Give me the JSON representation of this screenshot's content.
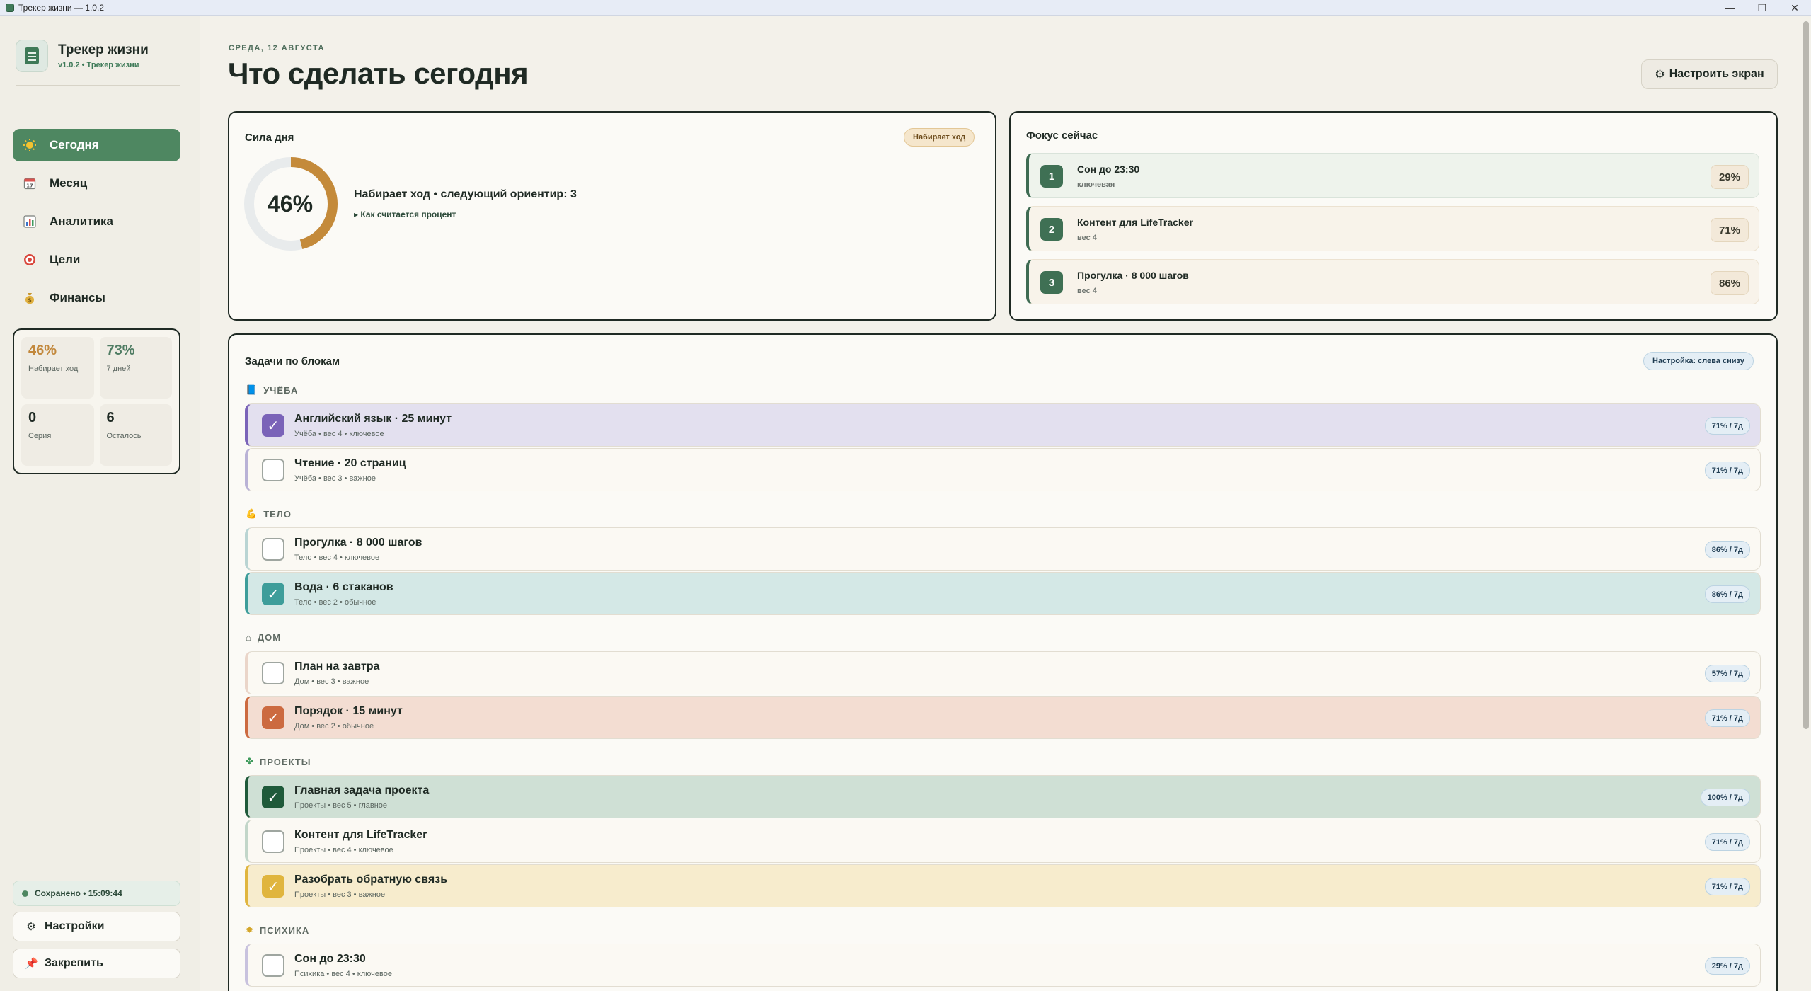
{
  "window": {
    "title": "Трекер жизни — 1.0.2",
    "controls": [
      "—",
      "❐",
      "✕"
    ]
  },
  "sidebar": {
    "brand_title": "Трекер жизни",
    "brand_sub": "v1.0.2 • Трекер жизни",
    "nav": [
      {
        "label": "Сегодня",
        "icon": "sun-icon"
      },
      {
        "label": "Месяц",
        "icon": "calendar-icon"
      },
      {
        "label": "Аналитика",
        "icon": "bar-chart-icon"
      },
      {
        "label": "Цели",
        "icon": "target-icon"
      },
      {
        "label": "Финансы",
        "icon": "money-bag-icon"
      }
    ],
    "stats": [
      {
        "value": "46%",
        "label": "Набирает ход"
      },
      {
        "value": "73%",
        "label": "7 дней"
      },
      {
        "value": "0",
        "label": "Серия"
      },
      {
        "value": "6",
        "label": "Осталось"
      }
    ],
    "saved": "Сохранено • 15:09:44",
    "settings_label": "Настройки",
    "pin_label": "Закрепить"
  },
  "header": {
    "date": "СРЕДА, 12 АВГУСТА",
    "title": "Что сделать сегодня",
    "config_button": "Настроить экран"
  },
  "power": {
    "title": "Сила дня",
    "badge": "Набирает ход",
    "percent_text": "46%",
    "percent_value": 46,
    "line": "Набирает ход • следующий ориентир: 3",
    "how": "Как считается процент",
    "colors": {
      "ring": "#c48a3a",
      "track": "#e8ebec"
    }
  },
  "focus": {
    "title": "Фокус сейчас",
    "items": [
      {
        "num": "1",
        "title": "Сон до 23:30",
        "sub": "ключевая",
        "pct": "29%"
      },
      {
        "num": "2",
        "title": "Контент для LifeTracker",
        "sub": "вес 4",
        "pct": "71%"
      },
      {
        "num": "3",
        "title": "Прогулка · 8 000 шагов",
        "sub": "вес 4",
        "pct": "86%"
      }
    ]
  },
  "tasks": {
    "title": "Задачи по блокам",
    "badge": "Настройка: слева снизу",
    "sections": [
      {
        "name": "УЧЁБА",
        "icon": "book-icon",
        "items": [
          {
            "title": "Английский язык · 25 минут",
            "sub": "Учёба • вес 4 • ключевое",
            "badge": "71% / 7д",
            "done": true,
            "color": "#7a63b8",
            "bg": "#e3e0ef"
          },
          {
            "title": "Чтение · 20 страниц",
            "sub": "Учёба • вес 3 • важное",
            "badge": "71% / 7д",
            "done": false,
            "color": "#b9b2d6",
            "bg": "#fbf9f3"
          }
        ]
      },
      {
        "name": "ТЕЛО",
        "icon": "muscle-icon",
        "items": [
          {
            "title": "Прогулка · 8 000 шагов",
            "sub": "Тело • вес 4 • ключевое",
            "badge": "86% / 7д",
            "done": false,
            "color": "#b9d4d3",
            "bg": "#fbf9f3"
          },
          {
            "title": "Вода · 6 стаканов",
            "sub": "Тело • вес 2 • обычное",
            "badge": "86% / 7д",
            "done": true,
            "color": "#3e9d9a",
            "bg": "#d4e8e6"
          }
        ]
      },
      {
        "name": "ДОМ",
        "icon": "house-icon",
        "items": [
          {
            "title": "План на завтра",
            "sub": "Дом • вес 3 • важное",
            "badge": "57% / 7д",
            "done": false,
            "color": "#ead5c9",
            "bg": "#fbf9f3"
          },
          {
            "title": "Порядок · 15 минут",
            "sub": "Дом • вес 2 • обычное",
            "badge": "71% / 7д",
            "done": true,
            "color": "#cc6a40",
            "bg": "#f3ddd2"
          }
        ]
      },
      {
        "name": "ПРОЕКТЫ",
        "icon": "puzzle-icon",
        "items": [
          {
            "title": "Главная задача проекта",
            "sub": "Проекты • вес 5 • главное",
            "badge": "100% / 7д",
            "done": true,
            "color": "#1f5a3a",
            "bg": "#cfe0d5"
          },
          {
            "title": "Контент для LifeTracker",
            "sub": "Проекты • вес 4 • ключевое",
            "badge": "71% / 7д",
            "done": false,
            "color": "#c2d6c9",
            "bg": "#fbf9f3"
          },
          {
            "title": "Разобрать обратную связь",
            "sub": "Проекты • вес 3 • важное",
            "badge": "71% / 7д",
            "done": true,
            "color": "#e0b53e",
            "bg": "#f7eccd"
          }
        ]
      },
      {
        "name": "ПСИХИКА",
        "icon": "sparkle-icon",
        "items": [
          {
            "title": "Сон до 23:30",
            "sub": "Психика • вес 4 • ключевое",
            "badge": "29% / 7д",
            "done": false,
            "color": "#c8c2de",
            "bg": "#fbf9f3"
          }
        ]
      }
    ]
  }
}
